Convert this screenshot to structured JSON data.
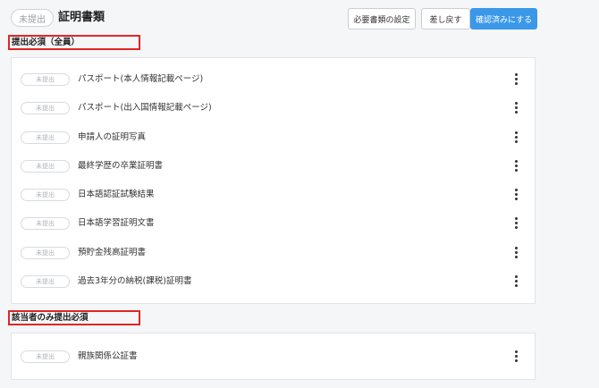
{
  "header": {
    "status": "未提出",
    "title": "証明書類",
    "buttons": {
      "required_settings": "必要書類の設定",
      "return": "差し戻す",
      "confirm": "確認済みにする"
    }
  },
  "sections": [
    {
      "heading": "提出必須（全員）",
      "documents": [
        {
          "status": "未提出",
          "name": "パスポート(本人情報記載ページ)"
        },
        {
          "status": "未提出",
          "name": "パスポート(出入国情報記載ページ)"
        },
        {
          "status": "未提出",
          "name": "申請人の証明写真"
        },
        {
          "status": "未提出",
          "name": "最終学歴の卒業証明書"
        },
        {
          "status": "未提出",
          "name": "日本語認証試験結果"
        },
        {
          "status": "未提出",
          "name": "日本語学習証明文書"
        },
        {
          "status": "未提出",
          "name": "預貯金残高証明書"
        },
        {
          "status": "未提出",
          "name": "過去3年分の納税(課税)証明書"
        }
      ]
    },
    {
      "heading": "該当者のみ提出必須",
      "documents": [
        {
          "status": "未提出",
          "name": "親族関係公証書"
        }
      ]
    }
  ],
  "icons": {
    "row_menu": "more-vertical-icon"
  },
  "colors": {
    "primary": "#3b98e8",
    "highlight_box": "#e02626"
  }
}
